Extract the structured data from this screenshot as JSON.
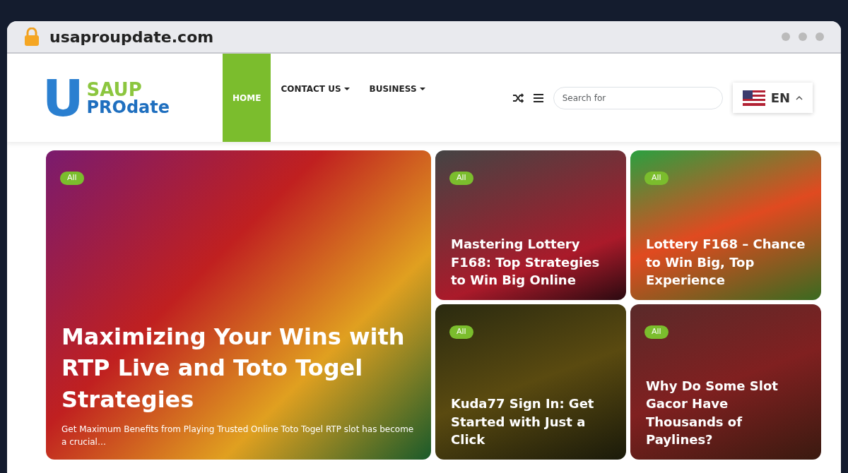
{
  "browser": {
    "url": "usaproupdate.com"
  },
  "logo": {
    "initial": "U",
    "top": "SAUP",
    "bottom": "PROdate"
  },
  "nav": [
    {
      "label": "HOME",
      "selected": true,
      "dropdown": false
    },
    {
      "label": "CONTACT US",
      "selected": false,
      "dropdown": true
    },
    {
      "label": "BUSINESS",
      "selected": false,
      "dropdown": true
    }
  ],
  "search": {
    "placeholder": "Search for"
  },
  "language": {
    "code": "EN"
  },
  "featured": {
    "badge": "All",
    "title": "Maximizing Your Wins with RTP Live and Toto Togel Strategies",
    "excerpt": "Get Maximum Benefits from Playing Trusted Online Toto Togel RTP slot has become a crucial…"
  },
  "posts": [
    {
      "badge": "All",
      "title": "Mastering Lottery F168: Top Strategies to Win Big Online"
    },
    {
      "badge": "All",
      "title": "Lottery F168 – Chance to Win Big, Top Experience"
    },
    {
      "badge": "All",
      "title": "Kuda77 Sign In: Get Started with Just a Click"
    },
    {
      "badge": "All",
      "title": "Why Do Some Slot Gacor Have Thousands of Paylines?"
    }
  ]
}
